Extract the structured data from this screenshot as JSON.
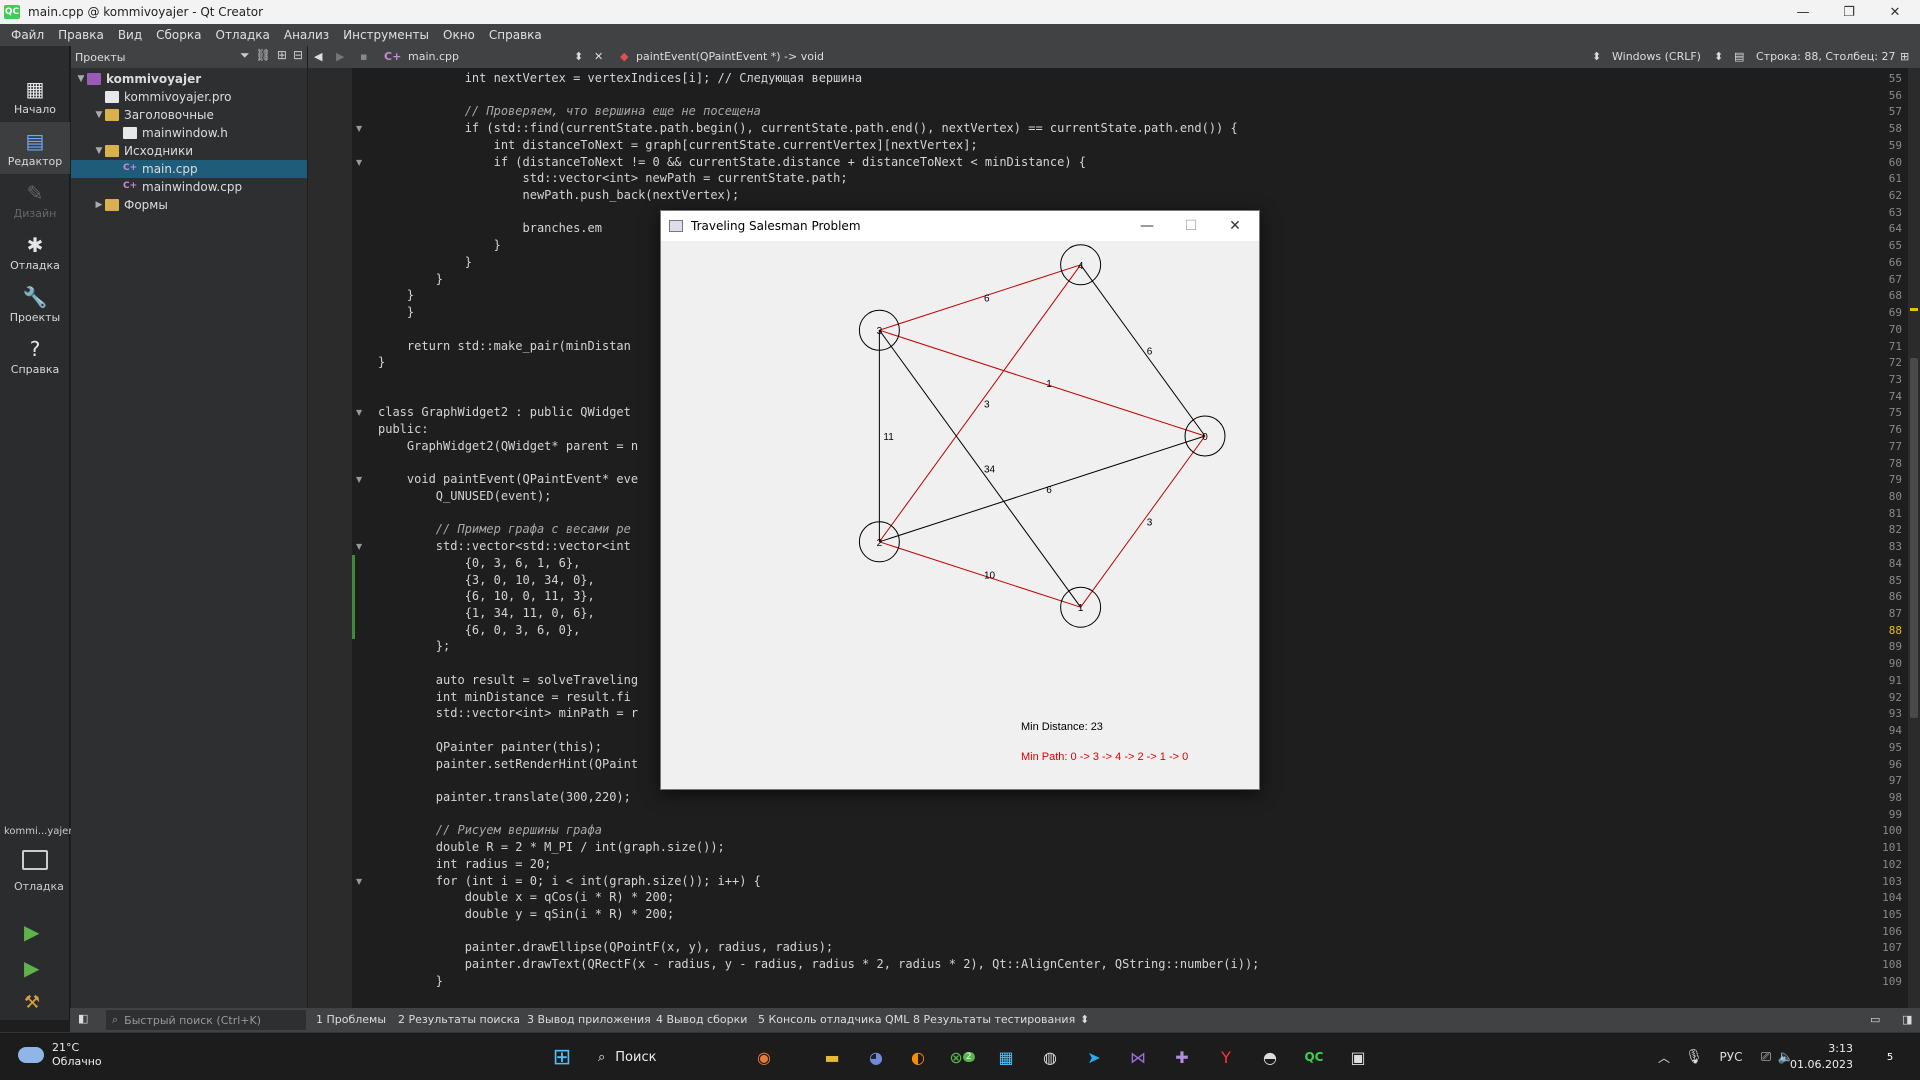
{
  "window": {
    "title": "main.cpp @ kommivoyajer - Qt Creator",
    "app_icon": "QC"
  },
  "menu": [
    "Файл",
    "Правка",
    "Вид",
    "Сборка",
    "Отладка",
    "Анализ",
    "Инструменты",
    "Окно",
    "Справка"
  ],
  "modes": [
    {
      "label": "Начало",
      "icon": "grid-icon"
    },
    {
      "label": "Редактор",
      "icon": "editor-icon"
    },
    {
      "label": "Дизайн",
      "icon": "pencil-icon"
    },
    {
      "label": "Отладка",
      "icon": "bug-icon"
    },
    {
      "label": "Проекты",
      "icon": "wrench-icon"
    },
    {
      "label": "Справка",
      "icon": "help-icon"
    }
  ],
  "kit": {
    "name": "kommi...yajer",
    "label": "Отладка"
  },
  "project_pane": {
    "header": "Проекты",
    "tree": [
      {
        "label": "kommivoyajer",
        "type": "proj",
        "depth": 0,
        "arrow": "▼",
        "bold": true
      },
      {
        "label": "kommivoyajer.pro",
        "type": "file",
        "depth": 1,
        "arrow": ""
      },
      {
        "label": "Заголовочные",
        "type": "folder",
        "depth": 1,
        "arrow": "▼"
      },
      {
        "label": "mainwindow.h",
        "type": "file",
        "depth": 2,
        "arrow": ""
      },
      {
        "label": "Исходники",
        "type": "folder",
        "depth": 1,
        "arrow": "▼"
      },
      {
        "label": "main.cpp",
        "type": "cpp",
        "depth": 2,
        "arrow": "",
        "selected": true
      },
      {
        "label": "mainwindow.cpp",
        "type": "cpp",
        "depth": 2,
        "arrow": ""
      },
      {
        "label": "Формы",
        "type": "folder",
        "depth": 1,
        "arrow": "▶"
      }
    ]
  },
  "editor_toolbar": {
    "file": "main.cpp",
    "symbol": "paintEvent(QPaintEvent *) -> void",
    "line_ending": "Windows (CRLF)",
    "position": "Строка: 88, Столбец: 27"
  },
  "code": {
    "first_line": 55,
    "current_line": 88,
    "lines": [
      "            int nextVertex = vertexIndices[i]; // Следующая вершина",
      "",
      "            // Проверяем, что вершина еще не посещена",
      "            if (std::find(currentState.path.begin(), currentState.path.end(), nextVertex) == currentState.path.end()) {",
      "                int distanceToNext = graph[currentState.currentVertex][nextVertex];",
      "                if (distanceToNext != 0 && currentState.distance + distanceToNext < minDistance) {",
      "                    std::vector<int> newPath = currentState.path;",
      "                    newPath.push_back(nextVertex);",
      "",
      "                    branches.em",
      "                }",
      "            }",
      "        }",
      "    }",
      "    }",
      "",
      "    return std::make_pair(minDistan",
      "}",
      "",
      "",
      "class GraphWidget2 : public QWidget",
      "public:",
      "    GraphWidget2(QWidget* parent = n",
      "",
      "    void paintEvent(QPaintEvent* eve",
      "        Q_UNUSED(event);",
      "",
      "        // Пример графа с весами ре",
      "        std::vector<std::vector<int",
      "            {0, 3, 6, 1, 6},",
      "            {3, 0, 10, 34, 0},",
      "            {6, 10, 0, 11, 3},",
      "            {1, 34, 11, 0, 6},",
      "            {6, 0, 3, 6, 0},",
      "        };",
      "",
      "        auto result = solveTraveling",
      "        int minDistance = result.fi",
      "        std::vector<int> minPath = r",
      "",
      "        QPainter painter(this);",
      "        painter.setRenderHint(QPaint",
      "",
      "        painter.translate(300,220);",
      "",
      "        // Рисуем вершины графа",
      "        double R = 2 * M_PI / int(graph.size());",
      "        int radius = 20;",
      "        for (int i = 0; i < int(graph.size()); i++) {",
      "            double x = qCos(i * R) * 200;",
      "            double y = qSin(i * R) * 200;",
      "",
      "            painter.drawEllipse(QPointF(x, y), radius, radius);",
      "            painter.drawText(QRectF(x - radius, y - radius, radius * 2, radius * 2), Qt::AlignCenter, QString::number(i));",
      "        }"
    ]
  },
  "output_bar": {
    "search_placeholder": "Быстрый поиск (Ctrl+K)",
    "tabs": [
      "1 Проблемы",
      "2 Результаты поиска",
      "3 Вывод приложения",
      "4 Вывод сборки",
      "5 Консоль отладчика QML",
      "8 Результаты тестирования"
    ]
  },
  "qt_window": {
    "title": "Traveling Salesman Problem",
    "min_distance": "Min Distance: 23",
    "min_path": "Min Path: 0 -> 3 -> 4 -> 2 -> 1 -> 0",
    "path_color": "#c00000",
    "edge_color": "#000000",
    "nodes": [
      "0",
      "1",
      "2",
      "3",
      "4"
    ],
    "edge_labels": [
      "6",
      "6",
      "1",
      "3",
      "11",
      "34",
      "6",
      "3",
      "10"
    ]
  },
  "taskbar": {
    "weather_temp": "21°C",
    "weather_desc": "Облачно",
    "search": "Поиск",
    "lang": "РУС",
    "time": "3:13",
    "date": "01.06.2023",
    "notif_count": "5",
    "xbox_badge": "2"
  }
}
